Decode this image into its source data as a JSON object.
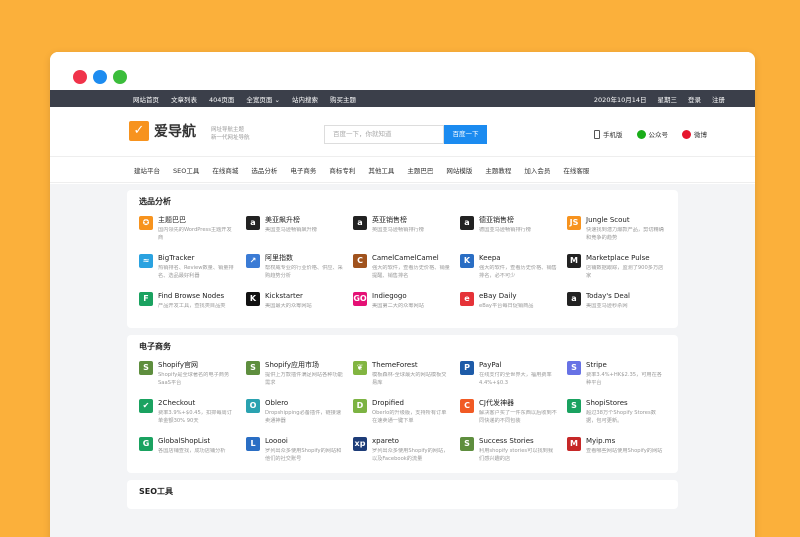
{
  "topbar": {
    "left": [
      "网站首页",
      "文章列表",
      "404页面",
      "全宽页面 ⌄",
      "站内搜索",
      "购买主题"
    ],
    "right": [
      "2020年10月14日",
      "星期三",
      "登录",
      "注册"
    ]
  },
  "header": {
    "logo_mark": "✓",
    "logo_text": "爱导航",
    "slogan1": "网址导航主题",
    "slogan2": "新一代网址导航",
    "search_placeholder": "百度一下，你就知道",
    "search_button": "百度一下",
    "mobile": "手机版",
    "wechat": "公众号",
    "weibo": "微博"
  },
  "nav": [
    "建站平台",
    "SEO工具",
    "在线商城",
    "选品分析",
    "电子商务",
    "商标专利",
    "其他工具",
    "主题巴巴",
    "网站模版",
    "主题教程",
    "加入会员",
    "在线客服"
  ],
  "sections": [
    {
      "title": "选品分析",
      "items": [
        {
          "name": "主题巴巴",
          "desc": "国内领先的WordPress主题开发商",
          "color": "#f7931e",
          "glyph": "✪"
        },
        {
          "name": "美亚飙升榜",
          "desc": "美国亚马逊畅销飙升榜",
          "color": "#222",
          "glyph": "a"
        },
        {
          "name": "英亚销售榜",
          "desc": "英国亚马逊畅销排行榜",
          "color": "#222",
          "glyph": "a"
        },
        {
          "name": "德亚销售榜",
          "desc": "德国亚马逊畅销排行榜",
          "color": "#222",
          "glyph": "a"
        },
        {
          "name": "Jungle Scout",
          "desc": "快速找到潜力爆款产品，剪切精确和竞争的趋势",
          "color": "#f7931e",
          "glyph": "JS"
        },
        {
          "name": "BigTracker",
          "desc": "热销排名、Review数量、销量排名、选品最好利器",
          "color": "#2aa2e0",
          "glyph": "≈"
        },
        {
          "name": "阿里指数",
          "desc": "帮权威专业的行业价格、供应、采购趋势分析",
          "color": "#3a7bd5",
          "glyph": "↗"
        },
        {
          "name": "CamelCamelCamel",
          "desc": "强大的软件，查看历史价格、销量提醒、销售排名",
          "color": "#a0521d",
          "glyph": "C"
        },
        {
          "name": "Keepa",
          "desc": "强大的软件，查看历史价格、销售排名，必不可少",
          "color": "#2a6ec4",
          "glyph": "K"
        },
        {
          "name": "Marketplace Pulse",
          "desc": "店铺数据跟踪，监测了900多万店家",
          "color": "#222",
          "glyph": "M"
        },
        {
          "name": "Find Browse Nodes",
          "desc": "产品开发工具，查找类目品类",
          "color": "#1aa260",
          "glyph": "F"
        },
        {
          "name": "Kickstarter",
          "desc": "美国最大的众筹网站",
          "color": "#111",
          "glyph": "K"
        },
        {
          "name": "Indiegogo",
          "desc": "美国第二大的众筹网站",
          "color": "#e51075",
          "glyph": "GO"
        },
        {
          "name": "eBay Daily",
          "desc": "eBay平台每日促销商品",
          "color": "#e53238",
          "glyph": "e"
        },
        {
          "name": "Today's Deal",
          "desc": "美国亚马逊秒杀网",
          "color": "#222",
          "glyph": "a"
        }
      ]
    },
    {
      "title": "电子商务",
      "items": [
        {
          "name": "Shopify官网",
          "desc": "Shopify是全球著名的电子商务SaaS平台",
          "color": "#5e8e3e",
          "glyph": "S"
        },
        {
          "name": "Shopify应用市场",
          "desc": "提供上万款插件满足网站各种功能需求",
          "color": "#5e8e3e",
          "glyph": "S"
        },
        {
          "name": "ThemeForest",
          "desc": "模板森林-全球最大的网站模板交易库",
          "color": "#82b541",
          "glyph": "❦"
        },
        {
          "name": "PayPal",
          "desc": "在线支付的全世界大，福用费率4.4%+$0.3",
          "color": "#1d5ba8",
          "glyph": "P"
        },
        {
          "name": "Stripe",
          "desc": "费率3.4%+HK$2.35，可用在各种平台",
          "color": "#6772e5",
          "glyph": "S"
        },
        {
          "name": "2Checkout",
          "desc": "费率3.9%+$0.45，扣抑每周订单金额30% 90天",
          "color": "#1aa260",
          "glyph": "✔"
        },
        {
          "name": "Oblero",
          "desc": "Dropshipping必备插件，链接速卖通神器",
          "color": "#2aa2b0",
          "glyph": "O"
        },
        {
          "name": "Dropified",
          "desc": "Oberlo的升级版，支持所有订单在速卖通一键下单",
          "color": "#7cb342",
          "glyph": "D"
        },
        {
          "name": "CJ代发神器",
          "desc": "解决客户买了一件东西以后收到不同快递的不同包装",
          "color": "#f15a24",
          "glyph": "C"
        },
        {
          "name": "ShopiStores",
          "desc": "超过38万个Shopify Stores数据，包可更新。",
          "color": "#1aa260",
          "glyph": "S"
        },
        {
          "name": "GlobalShopList",
          "desc": "各国店铺查找，成功店铺分析",
          "color": "#1aa260",
          "glyph": "G"
        },
        {
          "name": "Looooi",
          "desc": "罗列出众多使用Shopify的网站和他们的社交账号",
          "color": "#2a6ec4",
          "glyph": "L"
        },
        {
          "name": "xpareto",
          "desc": "罗列出众多使用Shopify的网站，以及Facebook的流量",
          "color": "#1d3c78",
          "glyph": "xp"
        },
        {
          "name": "Success Stories",
          "desc": "利用shopify stories可以找到我们感兴趣的店",
          "color": "#5e8e3e",
          "glyph": "S"
        },
        {
          "name": "Myip.ms",
          "desc": "查看哪些网站使用Shopify的网站",
          "color": "#c62828",
          "glyph": "M"
        }
      ]
    },
    {
      "title": "SEO工具",
      "items": []
    }
  ]
}
